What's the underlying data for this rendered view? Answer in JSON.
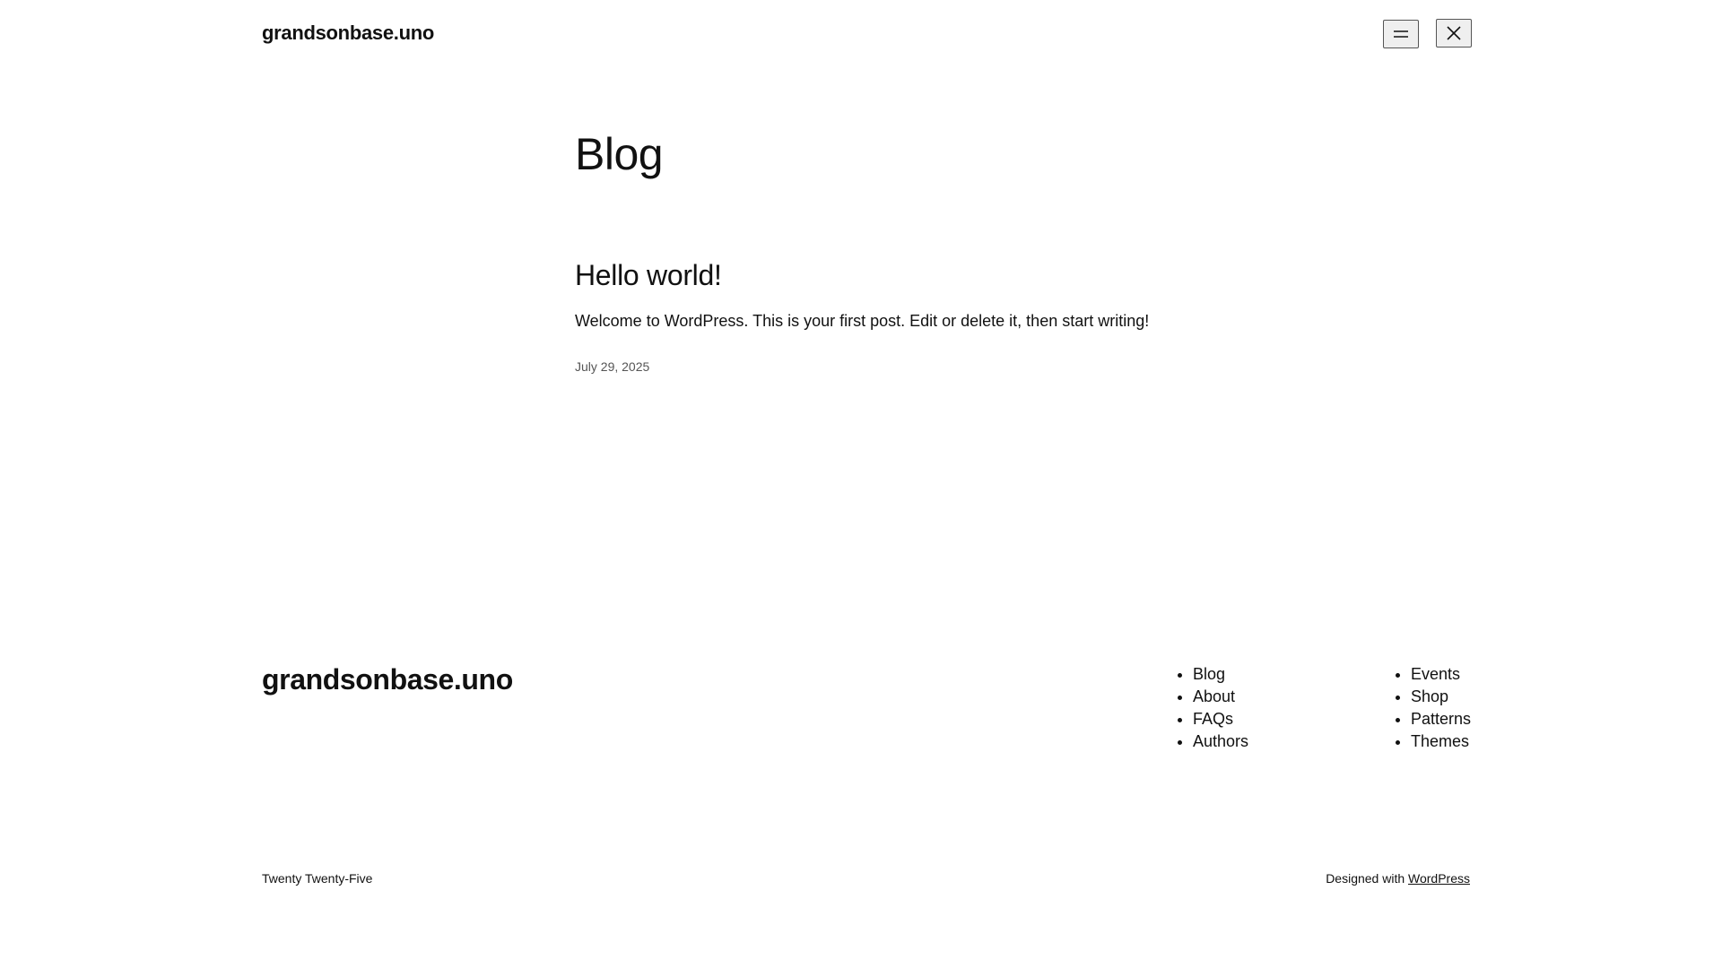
{
  "header": {
    "site_title": "grandsonbase.uno"
  },
  "main": {
    "page_title": "Blog",
    "posts": [
      {
        "title": "Hello world!",
        "excerpt": "Welcome to WordPress. This is your first post. Edit or delete it, then start writing!",
        "date": "July 29, 2025"
      }
    ]
  },
  "footer": {
    "site_title": "grandsonbase.uno",
    "nav_column_1": [
      "Blog",
      "About",
      "FAQs",
      "Authors"
    ],
    "nav_column_2": [
      "Events",
      "Shop",
      "Patterns",
      "Themes"
    ],
    "theme_name": "Twenty Twenty-Five",
    "credit_prefix": "Designed with",
    "credit_link": "WordPress"
  },
  "icons": {
    "menu": "hamburger-icon",
    "close": "close-icon"
  }
}
